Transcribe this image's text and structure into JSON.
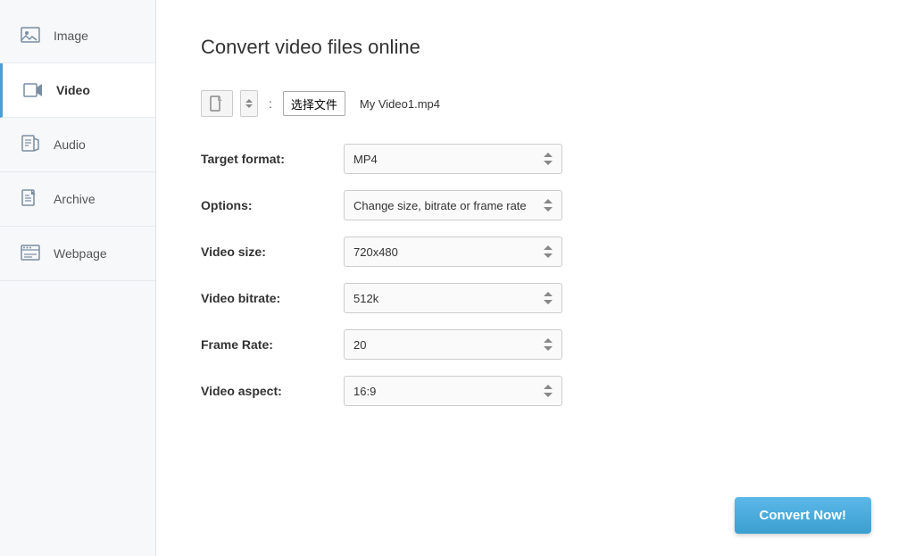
{
  "sidebar": {
    "items": [
      {
        "id": "image",
        "label": "Image",
        "icon": "image-icon"
      },
      {
        "id": "video",
        "label": "Video",
        "icon": "video-icon",
        "active": true
      },
      {
        "id": "audio",
        "label": "Audio",
        "icon": "audio-icon"
      },
      {
        "id": "archive",
        "label": "Archive",
        "icon": "archive-icon"
      },
      {
        "id": "webpage",
        "label": "Webpage",
        "icon": "webpage-icon"
      }
    ]
  },
  "main": {
    "title": "Convert video files online",
    "file_section": {
      "choose_label": "选择文件",
      "file_name": "My Video1.mp4",
      "colon": ":"
    },
    "form": {
      "target_format_label": "Target format:",
      "target_format_value": "MP4",
      "options_label": "Options:",
      "options_value": "Change size, bitrate or frame rate",
      "video_size_label": "Video size:",
      "video_size_value": "720x480",
      "video_bitrate_label": "Video bitrate:",
      "video_bitrate_value": "512k",
      "frame_rate_label": "Frame Rate:",
      "frame_rate_value": "20",
      "video_aspect_label": "Video aspect:",
      "video_aspect_value": "16:9"
    },
    "convert_button_label": "Convert Now!"
  }
}
